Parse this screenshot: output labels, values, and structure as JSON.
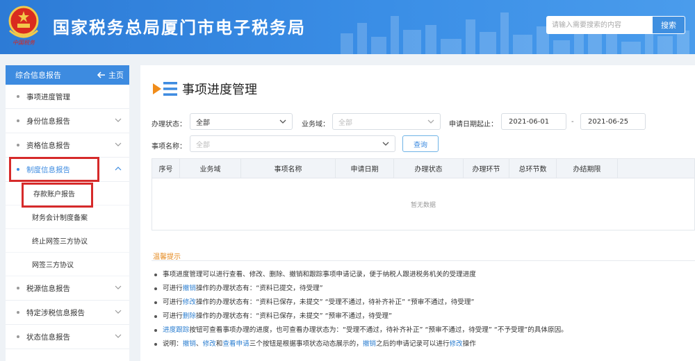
{
  "header": {
    "title": "国家税务总局厦门市电子税务局",
    "emblem_caption": "中国税务",
    "search_placeholder": "请输入需要搜索的内容",
    "search_button": "搜索"
  },
  "sidebar": {
    "title": "综合信息报告",
    "home_label": "主页",
    "items": [
      {
        "label": "事项进度管理",
        "has_chevron": false
      },
      {
        "label": "身份信息报告",
        "has_chevron": true
      },
      {
        "label": "资格信息报告",
        "has_chevron": true
      },
      {
        "label": "制度信息报告",
        "has_chevron": true,
        "expanded": true,
        "highlighted": true
      }
    ],
    "subitems": [
      "存款账户报告",
      "财务会计制度备案",
      "终止网签三方协议",
      "网签三方协议"
    ],
    "items_after": [
      {
        "label": "税源信息报告",
        "has_chevron": true
      },
      {
        "label": "特定涉税信息报告",
        "has_chevron": true
      },
      {
        "label": "状态信息报告",
        "has_chevron": true
      }
    ]
  },
  "main": {
    "page_title": "事项进度管理",
    "filters": {
      "status_label": "办理状态：",
      "status_value": "全部",
      "domain_label": "业务域：",
      "domain_placeholder": "全部",
      "date_label": "申请日期起止：",
      "date_start": "2021-06-01",
      "date_sep": "-",
      "date_end": "2021-06-25",
      "name_label": "事项名称：",
      "name_placeholder": "全部",
      "query_button": "查询"
    },
    "table": {
      "columns": [
        "序号",
        "业务域",
        "事项名称",
        "申请日期",
        "办理状态",
        "办理环节",
        "总环节数",
        "办结期限"
      ],
      "empty_text": "暂无数据"
    },
    "tips_title": "温馨提示",
    "tips": [
      [
        {
          "t": "事项进度管理可以进行查看、修改、删除、撤销和跟踪事项申请记录，便于纳税人跟进税务机关的受理进度"
        }
      ],
      [
        {
          "t": "可进行"
        },
        {
          "t": "撤销",
          "link": true
        },
        {
          "t": "操作的办理状态有：“资料已提交，待受理”"
        }
      ],
      [
        {
          "t": "可进行"
        },
        {
          "t": "修改",
          "link": true
        },
        {
          "t": "操作的办理状态有：“资料已保存，未提交”   “受理不通过，待补齐补正”   “预审不通过，待受理”"
        }
      ],
      [
        {
          "t": "可进行"
        },
        {
          "t": "删除",
          "link": true
        },
        {
          "t": "操作的办理状态有：“资料已保存，未提交”   “预审不通过，待受理”"
        }
      ],
      [
        {
          "t": "进度跟踪",
          "link": true
        },
        {
          "t": "按钮可查看事项办理的进度，也可查看办理状态为：“受理不通过，待补齐补正”   “预审不通过，待受理”   “不予受理”的具体原因。"
        }
      ],
      [
        {
          "t": "说明："
        },
        {
          "t": "撤销",
          "link": true
        },
        {
          "t": "、"
        },
        {
          "t": "修改",
          "link": true
        },
        {
          "t": "和"
        },
        {
          "t": "查看申请",
          "link": true
        },
        {
          "t": "三个按钮是根据事项状态动态展示的，"
        },
        {
          "t": "撤销",
          "link": true
        },
        {
          "t": "之后的申请记录可以进行"
        },
        {
          "t": "修改",
          "link": true
        },
        {
          "t": "操作"
        }
      ]
    ]
  },
  "colors": {
    "header_blue": "#3a8ee6",
    "accent_blue": "#3d8be0",
    "highlight_red": "#d62a2a",
    "tips_orange": "#e58a1f"
  }
}
